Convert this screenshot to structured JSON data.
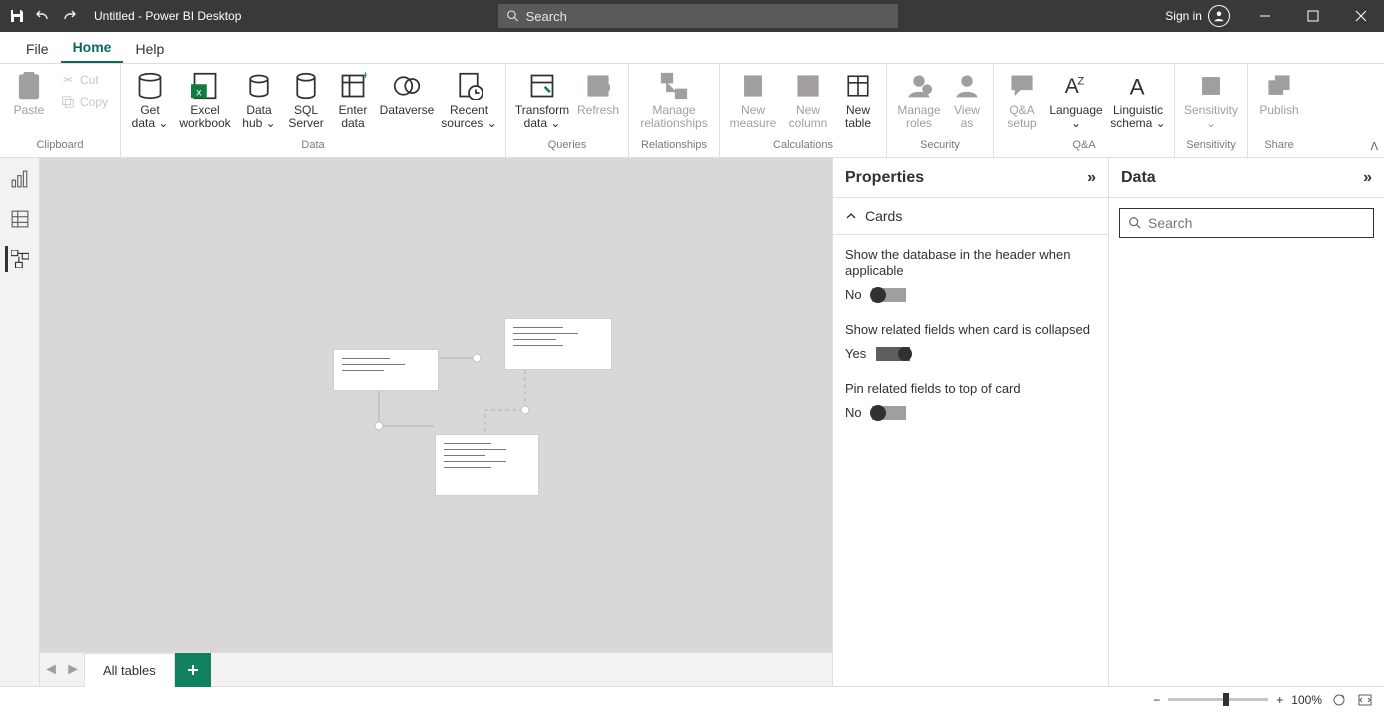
{
  "titlebar": {
    "title": "Untitled - Power BI Desktop",
    "search_placeholder": "Search",
    "signin": "Sign in"
  },
  "tabs": {
    "file": "File",
    "home": "Home",
    "help": "Help"
  },
  "ribbon": {
    "clipboard": {
      "paste": "Paste",
      "cut": "Cut",
      "copy": "Copy",
      "label": "Clipboard"
    },
    "data": {
      "get_data": "Get data",
      "excel_workbook": "Excel workbook",
      "data_hub": "Data hub",
      "sql_server": "SQL Server",
      "enter_data": "Enter data",
      "dataverse": "Dataverse",
      "recent_sources": "Recent sources",
      "label": "Data"
    },
    "queries": {
      "transform_data": "Transform data",
      "refresh": "Refresh",
      "label": "Queries"
    },
    "relationships": {
      "manage_relationships": "Manage relationships",
      "label": "Relationships"
    },
    "calculations": {
      "new_measure": "New measure",
      "new_column": "New column",
      "new_table": "New table",
      "label": "Calculations"
    },
    "security": {
      "manage_roles": "Manage roles",
      "view_as": "View as",
      "label": "Security"
    },
    "qa": {
      "qa_setup": "Q&A setup",
      "language": "Language",
      "linguistic_schema": "Linguistic schema",
      "label": "Q&A"
    },
    "sensitivity": {
      "sensitivity": "Sensitivity",
      "label": "Sensitivity"
    },
    "share": {
      "publish": "Publish",
      "label": "Share"
    }
  },
  "pages": {
    "all_tables": "All tables"
  },
  "properties": {
    "header": "Properties",
    "section": "Cards",
    "show_db_header": {
      "label": "Show the database in the header when applicable",
      "value": "No"
    },
    "show_related": {
      "label": "Show related fields when card is collapsed",
      "value": "Yes"
    },
    "pin_related": {
      "label": "Pin related fields to top of card",
      "value": "No"
    }
  },
  "datapane": {
    "header": "Data",
    "search_placeholder": "Search"
  },
  "statusbar": {
    "zoom": "100%"
  }
}
